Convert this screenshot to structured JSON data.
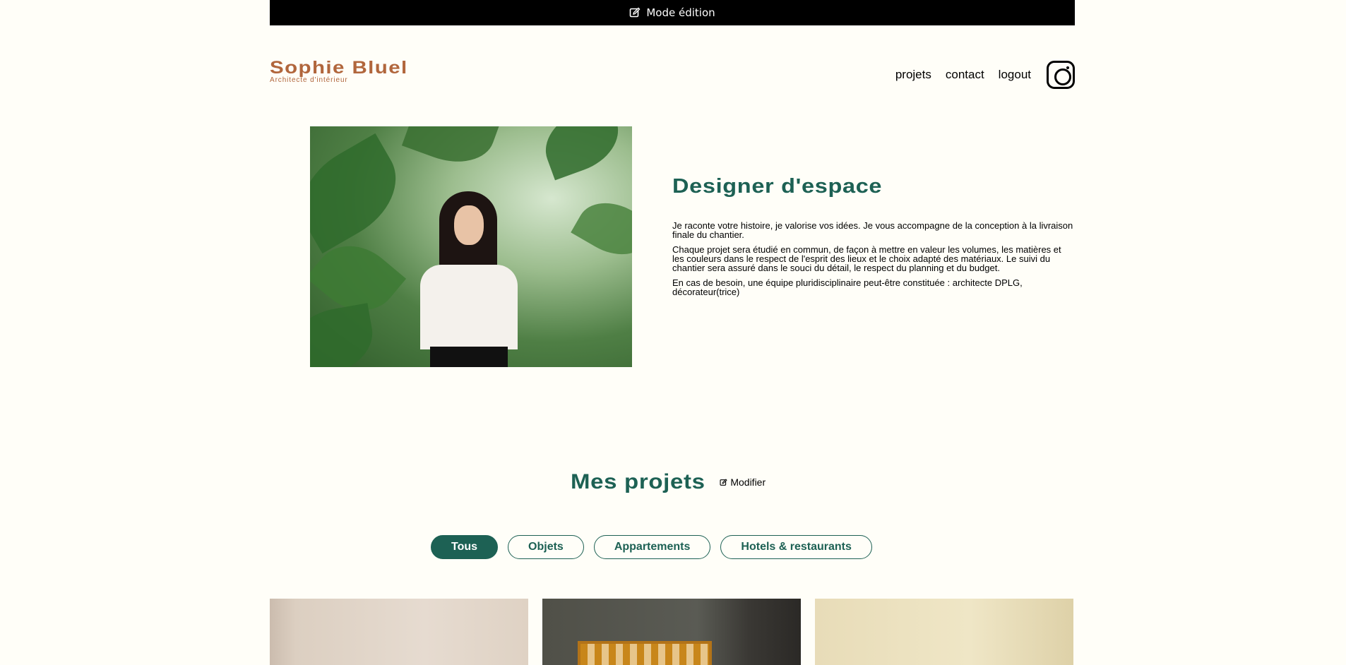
{
  "edit_bar": {
    "label": "Mode édition",
    "icon": "edit-icon"
  },
  "header": {
    "logo_name": "Sophie Bluel",
    "logo_subtitle": "Architecte d'intérieur",
    "nav": [
      "projets",
      "contact",
      "logout"
    ],
    "social_icon": "instagram-icon"
  },
  "intro": {
    "title": "Designer d'espace",
    "paragraphs": [
      "Je raconte votre histoire, je valorise vos idées. Je vous accompagne de la conception à la livraison finale du chantier.",
      "Chaque projet sera étudié en commun, de façon à mettre en valeur les volumes, les matières et les couleurs dans le respect de l'esprit des lieux et le choix adapté des matériaux. Le suivi du chantier sera assuré dans le souci du détail, le respect du planning et du budget.",
      "En cas de besoin, une équipe pluridisciplinaire peut-être constituée : architecte DPLG, décorateur(trice)"
    ]
  },
  "portfolio": {
    "title": "Mes projets",
    "edit_label": "Modifier",
    "filters": [
      "Tous",
      "Objets",
      "Appartements",
      "Hotels & restaurants"
    ],
    "active_filter": "Tous"
  },
  "colors": {
    "accent": "#1d6154",
    "brand": "#b1663c",
    "background": "#fffef8"
  }
}
